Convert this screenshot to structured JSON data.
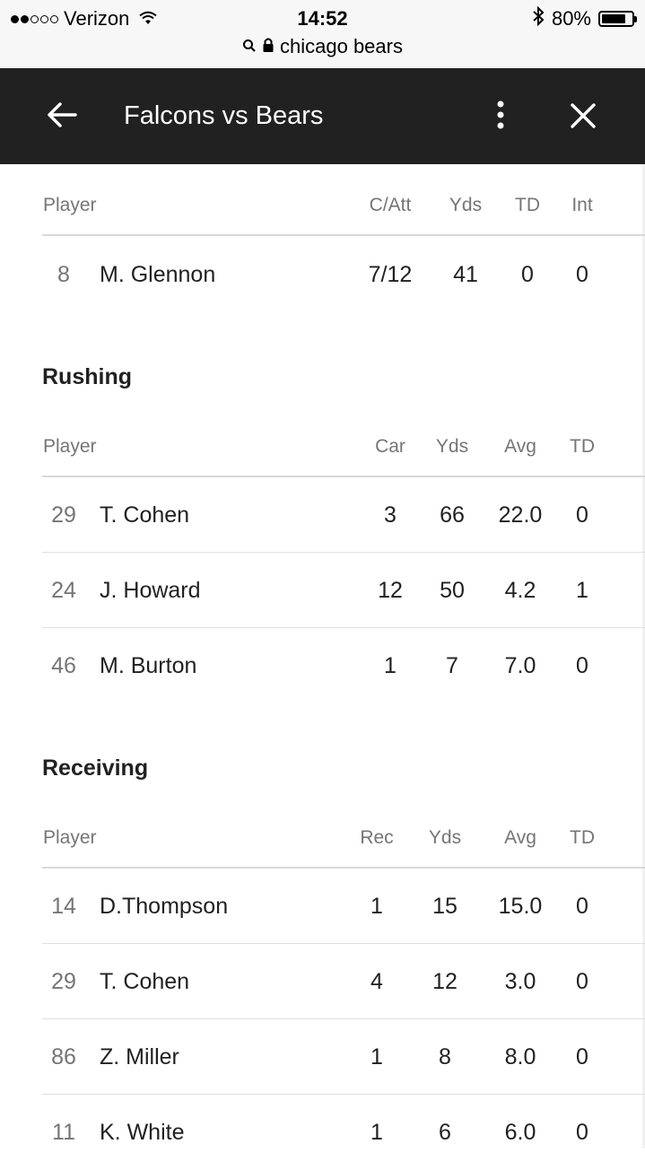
{
  "status_bar": {
    "carrier": "Verizon",
    "time": "14:52",
    "battery_percent": "80%",
    "battery_level": 0.8,
    "url": "chicago bears",
    "icons": [
      "signal-dots-icon",
      "wifi-icon",
      "bluetooth-icon",
      "battery-icon",
      "search-icon",
      "lock-icon"
    ]
  },
  "app_bar": {
    "title": "Falcons vs Bears",
    "icons": [
      "back-arrow-icon",
      "more-vert-icon",
      "close-icon"
    ]
  },
  "passing": {
    "headers": {
      "player": "Player",
      "c1": "C/Att",
      "c2": "Yds",
      "c3": "TD",
      "c4": "Int"
    },
    "rows": [
      {
        "num": "8",
        "name": "M. Glennon",
        "c1": "7/12",
        "c2": "41",
        "c3": "0",
        "c4": "0"
      }
    ]
  },
  "rushing": {
    "title": "Rushing",
    "headers": {
      "player": "Player",
      "c1": "Car",
      "c2": "Yds",
      "c3": "Avg",
      "c4": "TD"
    },
    "rows": [
      {
        "num": "29",
        "name": "T. Cohen",
        "c1": "3",
        "c2": "66",
        "c3": "22.0",
        "c4": "0"
      },
      {
        "num": "24",
        "name": "J. Howard",
        "c1": "12",
        "c2": "50",
        "c3": "4.2",
        "c4": "1"
      },
      {
        "num": "46",
        "name": "M. Burton",
        "c1": "1",
        "c2": "7",
        "c3": "7.0",
        "c4": "0"
      }
    ]
  },
  "receiving": {
    "title": "Receiving",
    "headers": {
      "player": "Player",
      "c1": "Rec",
      "c2": "Yds",
      "c3": "Avg",
      "c4": "TD"
    },
    "rows": [
      {
        "num": "14",
        "name": "D.Thompson",
        "c1": "1",
        "c2": "15",
        "c3": "15.0",
        "c4": "0"
      },
      {
        "num": "29",
        "name": "T. Cohen",
        "c1": "4",
        "c2": "12",
        "c3": "3.0",
        "c4": "0"
      },
      {
        "num": "86",
        "name": "Z. Miller",
        "c1": "1",
        "c2": "8",
        "c3": "8.0",
        "c4": "0"
      },
      {
        "num": "11",
        "name": "K. White",
        "c1": "1",
        "c2": "6",
        "c3": "6.0",
        "c4": "0"
      }
    ]
  }
}
